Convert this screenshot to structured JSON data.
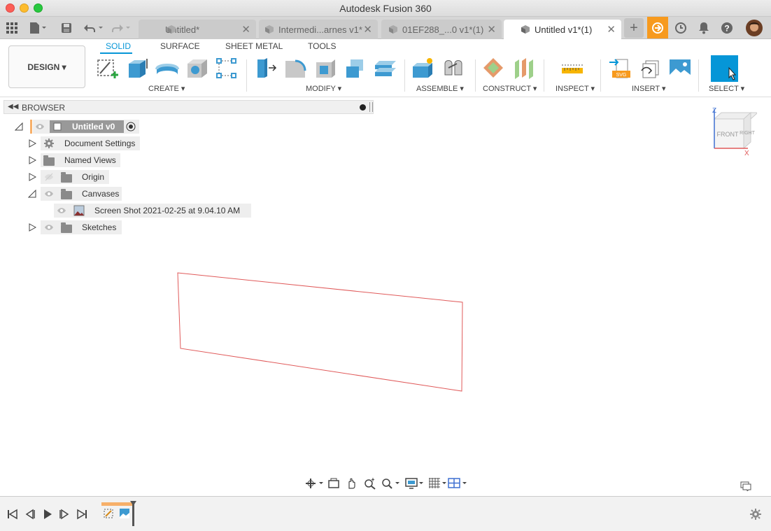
{
  "window": {
    "title": "Autodesk Fusion 360"
  },
  "tabs": [
    {
      "label": "Untitled*",
      "active": false
    },
    {
      "label": "Intermedi...arnes v1*",
      "active": false
    },
    {
      "label": "01EF288_...0 v1*(1)",
      "active": false
    },
    {
      "label": "Untitled v1*(1)",
      "active": true
    }
  ],
  "toolbar": {
    "workspace": "DESIGN",
    "ribbon_tabs": [
      "SOLID",
      "SURFACE",
      "SHEET METAL",
      "TOOLS"
    ],
    "active_ribbon_tab": "SOLID",
    "groups": [
      "CREATE",
      "MODIFY",
      "ASSEMBLE",
      "CONSTRUCT",
      "INSPECT",
      "INSERT",
      "SELECT"
    ]
  },
  "browser": {
    "title": "BROWSER",
    "root": "Untitled v0",
    "items": [
      "Document Settings",
      "Named Views",
      "Origin",
      "Canvases",
      "Screen Shot 2021-02-25 at 9.04.10 AM",
      "Sketches"
    ]
  },
  "viewcube": {
    "front": "FRONT",
    "right": "RIGHT",
    "axis_z": "Z",
    "axis_x": "X"
  },
  "colors": {
    "accent": "#0696d7",
    "sketch_line": "#e05a5a",
    "notify": "#f79a1e"
  },
  "icons": [
    "grid-icon",
    "file-icon",
    "save-icon",
    "undo-icon",
    "redo-icon",
    "add-tab-icon",
    "job-status-icon",
    "clock-icon",
    "bell-icon",
    "help-icon",
    "eye-icon",
    "gear-icon",
    "folder-icon"
  ]
}
